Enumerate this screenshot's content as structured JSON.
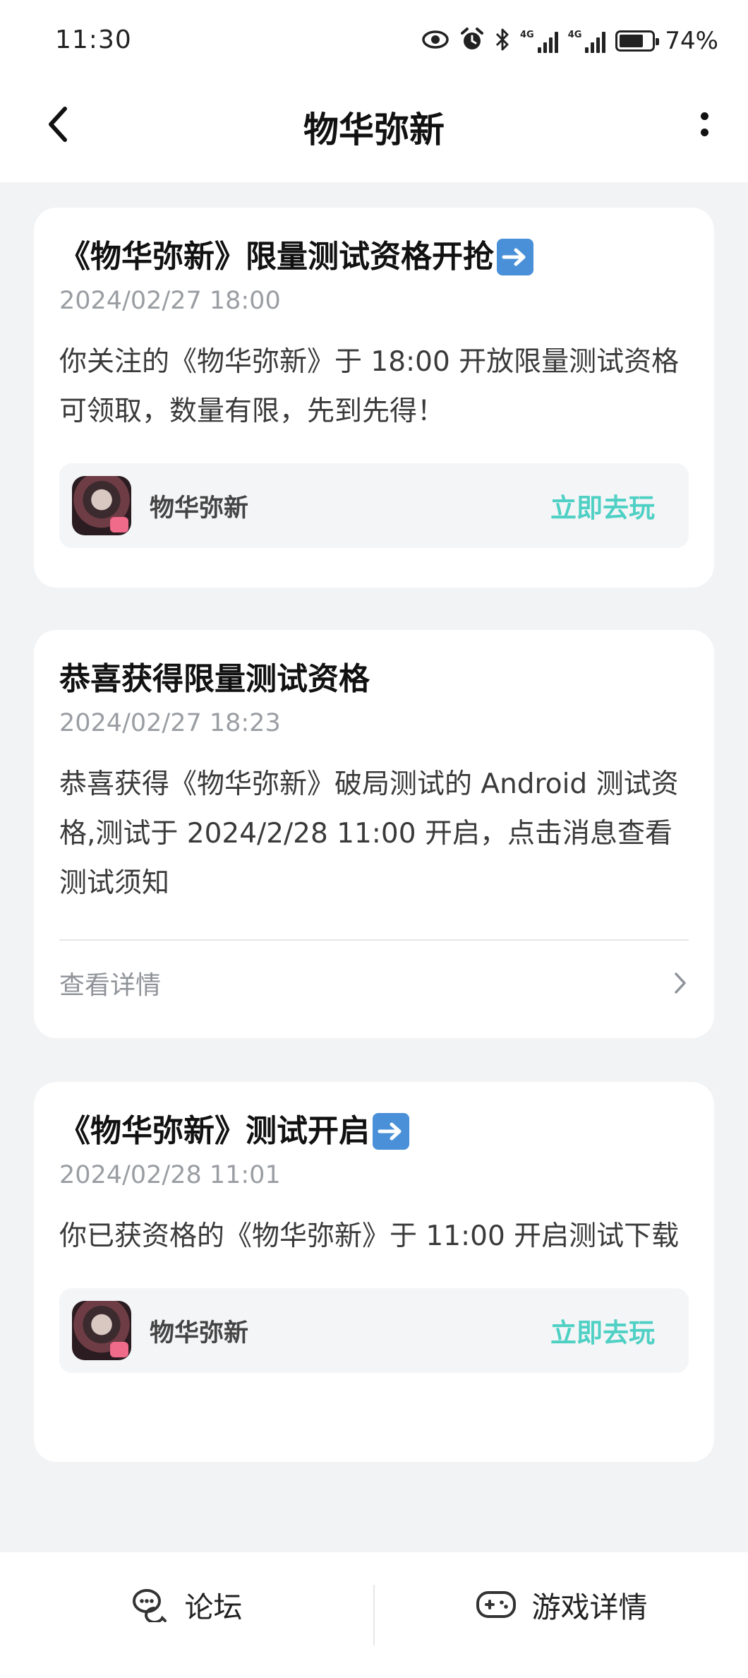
{
  "status": {
    "time": "11:30",
    "network_1": "4G",
    "network_2": "4G",
    "battery_percent": "74%",
    "battery_level": 0.74,
    "icons": [
      "eye-icon",
      "alarm-icon",
      "bluetooth-icon",
      "signal-icon",
      "signal-icon",
      "battery-icon"
    ]
  },
  "header": {
    "title": "物华弥新"
  },
  "messages": [
    {
      "title": "《物华弥新》限量测试资格开抢",
      "time": "2024/02/27 18:00",
      "body": "你关注的《物华弥新》于 18:00 开放限量测试资格可领取，数量有限，先到先得！",
      "game_name": "物华弥新",
      "action": "立即去玩"
    },
    {
      "title": "恭喜获得限量测试资格",
      "time": "2024/02/27 18:23",
      "body": "恭喜获得《物华弥新》破局测试的 Android 测试资格,测试于 2024/2/28 11:00 开启，点击消息查看测试须知",
      "detail_label": "查看详情"
    },
    {
      "title": "《物华弥新》测试开启",
      "time": "2024/02/28 11:01",
      "body": "你已获资格的《物华弥新》于 11:00 开启测试下载",
      "game_name": "物华弥新",
      "action": "立即去玩"
    }
  ],
  "bottom_tabs": [
    {
      "label": "论坛",
      "icon": "forum-icon"
    },
    {
      "label": "游戏详情",
      "icon": "gamepad-icon"
    }
  ],
  "colors": {
    "accent": "#4fd0c4",
    "background": "#f2f3f5",
    "card": "#ffffff"
  }
}
